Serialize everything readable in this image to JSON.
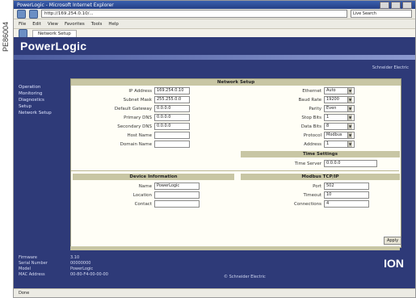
{
  "side_id": "PE86004",
  "window": {
    "title": "PowerLogic - Microsoft Internet Explorer"
  },
  "address": {
    "url": "http://169.254.0.10/...",
    "search_placeholder": "Live Search"
  },
  "menu": [
    "File",
    "Edit",
    "View",
    "Favorites",
    "Tools",
    "Help"
  ],
  "favorites_tab": "Network Setup",
  "app": {
    "brand": "PowerLogic",
    "header_info": "Schneider Electric",
    "nav": [
      "Operation",
      "Monitoring",
      "Diagnostics",
      "Setup",
      "Network Setup"
    ],
    "panel_title": "Network Setup",
    "left_fields": [
      {
        "label": "IP Address",
        "value": "169.254.0.10"
      },
      {
        "label": "Subnet Mask",
        "value": "255.255.0.0"
      },
      {
        "label": "Default Gateway",
        "value": "0.0.0.0"
      },
      {
        "label": "Primary DNS",
        "value": "0.0.0.0"
      },
      {
        "label": "Secondary DNS",
        "value": "0.0.0.0"
      },
      {
        "label": "Host Name",
        "value": ""
      },
      {
        "label": "Domain Name",
        "value": ""
      }
    ],
    "right_fields": [
      {
        "label": "Ethernet",
        "value": "Auto"
      },
      {
        "label": "Baud Rate",
        "value": "19200"
      },
      {
        "label": "Parity",
        "value": "Even"
      },
      {
        "label": "Stop Bits",
        "value": "1"
      },
      {
        "label": "Data Bits",
        "value": "8"
      },
      {
        "label": "Protocol",
        "value": "Modbus"
      },
      {
        "label": "Address",
        "value": "1"
      }
    ],
    "section_right1": "Time Settings",
    "time_field": {
      "label": "Time Server",
      "value": "0.0.0.0"
    },
    "section_left2": "Device Information",
    "section_right2": "Modbus TCP/IP",
    "device_fields": [
      {
        "label": "Name",
        "value": "PowerLogic"
      },
      {
        "label": "Location",
        "value": ""
      },
      {
        "label": "Contact",
        "value": ""
      }
    ],
    "modbus_fields": [
      {
        "label": "Port",
        "value": "502"
      },
      {
        "label": "Timeout",
        "value": "10"
      },
      {
        "label": "Connections",
        "value": "4"
      }
    ],
    "ok_label": "Apply",
    "bottom_left": [
      "Firmware",
      "Serial Number",
      "Model",
      "MAC Address"
    ],
    "bottom_values": [
      "3.10",
      "00000000",
      "PowerLogic",
      "00-80-F4-00-00-00"
    ],
    "copyright": "© Schneider Electric",
    "logo": "ION"
  },
  "status_text": "Done"
}
